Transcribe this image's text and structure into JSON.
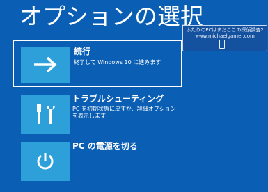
{
  "page": {
    "title": "オプションの選択"
  },
  "options": [
    {
      "label": "続行",
      "description": "終了して Windows 10 に進みます",
      "icon": "arrow-right-icon"
    },
    {
      "label": "トラブルシューティング",
      "description": "PC を初期状態に戻すか、詳細オプションを表示します",
      "icon": "tools-icon"
    },
    {
      "label": "PC の電源を切る",
      "description": "",
      "icon": "power-icon"
    }
  ],
  "watermark": {
    "line1": "ふたりのPCはまだここの探偵調査2",
    "line2": "www.michaelgamer.com"
  },
  "colors": {
    "background": "#0a5fb4",
    "tile": "#2d9fd9",
    "text": "#ffffff"
  }
}
